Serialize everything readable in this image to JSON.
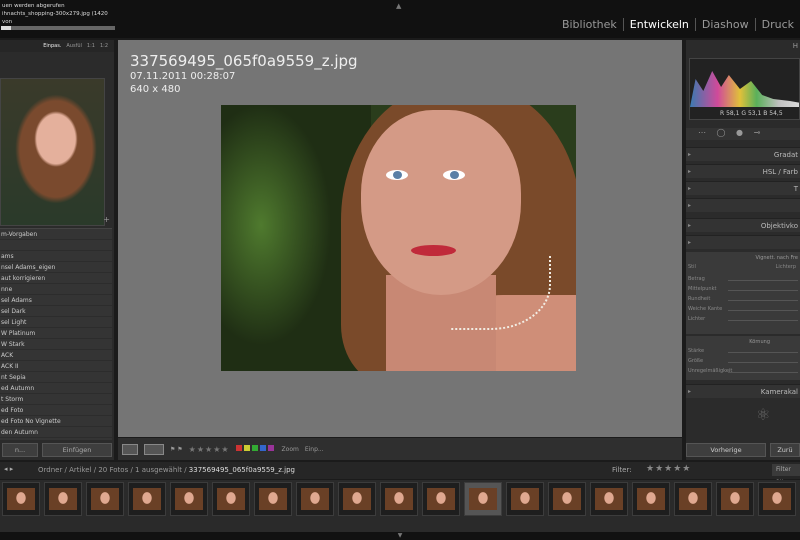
{
  "progress": {
    "line1": "uen werden abgerufen",
    "line2": "ihnachts_shopping-300x279.jpg (1420 von",
    "fraction": 0.09
  },
  "modules": [
    "Bibliothek",
    "Entwickeln",
    "Diashow",
    "Druck"
  ],
  "active_module": "Entwickeln",
  "navigator": {
    "options": [
      "Einpas.",
      "Ausfül",
      "1:1",
      "1:2"
    ],
    "active": "Einpas."
  },
  "presets": [
    "m-Vorgaben",
    "",
    "ams",
    "nsel Adams_eigen",
    "aut korrigieren",
    "nne",
    "sel Adams",
    "sel Dark",
    "sel Light",
    "W Platinum",
    "W Stark",
    "ACK",
    "ACK II",
    "nt Sepia",
    "ed Autumn",
    "t Storm",
    "ed Foto",
    "ed Foto No Vignette",
    "den Autumn"
  ],
  "left_buttons": {
    "copy": "n...",
    "paste": "Einfügen"
  },
  "image": {
    "filename": "337569495_065f0a9559_z.jpg",
    "date": "07.11.2011 00:28:07",
    "size": "640 x 480"
  },
  "toolbar": {
    "stars": "★★★★★",
    "zoom": "Zoom",
    "zoom_value": "Einp..."
  },
  "right_header": "H",
  "histogram": {
    "r_label": "R",
    "r": "58,1",
    "g_label": "G",
    "g": "53,1",
    "b_label": "B",
    "b": "54,5"
  },
  "right_panels": [
    "Gradat",
    "HSL / Farb",
    "T",
    "",
    "Objektivko",
    ""
  ],
  "vignette": {
    "title": "Vignett. nach Fre",
    "style": "Stil",
    "style_value": "Lichterp",
    "rows": [
      "Betrag",
      "Mittelpunkt",
      "Rundheit",
      "Weiche Kante",
      "Lichter"
    ]
  },
  "grain": {
    "title": "Körnung",
    "rows": [
      "Stärke",
      "Größe",
      "Unregelmäßigkeit"
    ]
  },
  "camera_panel": "Kamerakal",
  "right_buttons": {
    "prev": "Vorherige",
    "reset": "Zurü"
  },
  "filmstrip_bar": {
    "path": "Ordner / Artikel / 20 Fotos / 1 ausgewählt /",
    "file": "337569495_065f0a9559_z.jpg",
    "filter": "Filter:",
    "filter_off": "Filter au"
  },
  "thumbnail_count": 19
}
